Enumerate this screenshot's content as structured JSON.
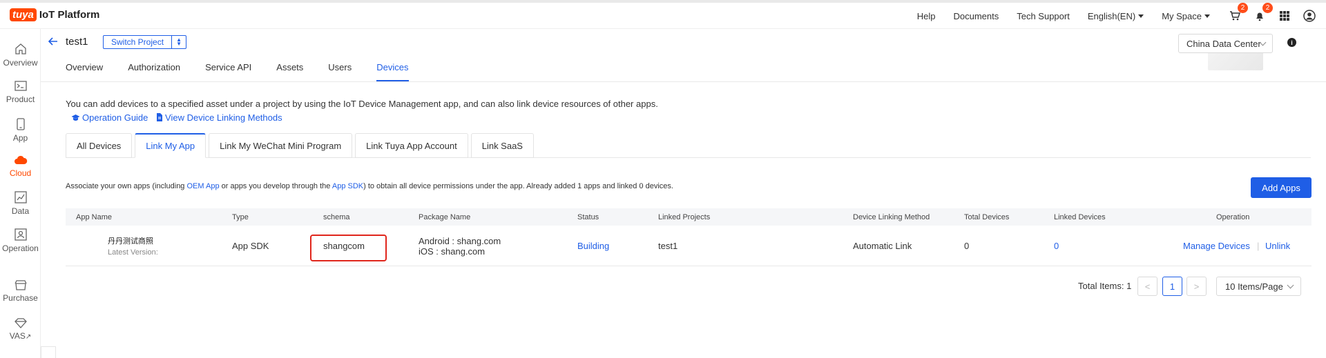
{
  "topbar": {
    "logo_badge": "tuya",
    "logo_text": "IoT Platform",
    "help": "Help",
    "documents": "Documents",
    "tech_support": "Tech Support",
    "language": "English(EN)",
    "my_space": "My Space",
    "cart_badge": "2",
    "bell_badge": "2"
  },
  "sidebar": {
    "items": [
      {
        "label": "Overview",
        "icon": "home-icon"
      },
      {
        "label": "Product",
        "icon": "terminal-icon"
      },
      {
        "label": "App",
        "icon": "phone-icon"
      },
      {
        "label": "Cloud",
        "icon": "cloud-icon"
      },
      {
        "label": "Data",
        "icon": "chart-icon"
      },
      {
        "label": "Operation",
        "icon": "operation-icon"
      },
      {
        "label": "Purchase",
        "icon": "shop-icon"
      },
      {
        "label": "VAS",
        "icon": "diamond-icon"
      }
    ]
  },
  "project": {
    "name": "test1",
    "switch_label": "Switch Project",
    "data_center": "China Data Center",
    "tabs": [
      "Overview",
      "Authorization",
      "Service API",
      "Assets",
      "Users",
      "Devices"
    ]
  },
  "intro": {
    "text": "You can add devices to a specified asset under a project by using the IoT Device Management app, and can also link device resources of other apps.",
    "guide_link": "Operation Guide",
    "methods_link": "View Device Linking Methods"
  },
  "subtabs": [
    "All Devices",
    "Link My App",
    "Link My WeChat Mini Program",
    "Link Tuya App Account",
    "Link SaaS"
  ],
  "assoc": {
    "prefix": "Associate your own apps (including ",
    "oem_link": "OEM App",
    "middle": " or apps you develop through the ",
    "sdk_link": "App SDK",
    "suffix": ") to obtain all device permissions under the app. Already added 1 apps and linked 0 devices."
  },
  "add_apps_label": "Add Apps",
  "table": {
    "headers": [
      "App Name",
      "Type",
      "schema",
      "Package Name",
      "Status",
      "Linked Projects",
      "Device Linking Method",
      "Total Devices",
      "Linked Devices",
      "Operation"
    ],
    "row": {
      "app_name": "丹丹测试商照",
      "latest_version": "Latest Version:",
      "type": "App SDK",
      "schema": "shangcom",
      "android_pkg": "Android : shang.com",
      "ios_pkg": "iOS : shang.com",
      "status": "Building",
      "linked_projects": "test1",
      "linking_method": "Automatic Link",
      "total_devices": "0",
      "linked_devices": "0",
      "manage_devices": "Manage Devices",
      "unlink": "Unlink"
    }
  },
  "pagination": {
    "total": "Total Items: 1",
    "prev": "<",
    "current": "1",
    "next": ">",
    "per_page": "10 Items/Page"
  }
}
